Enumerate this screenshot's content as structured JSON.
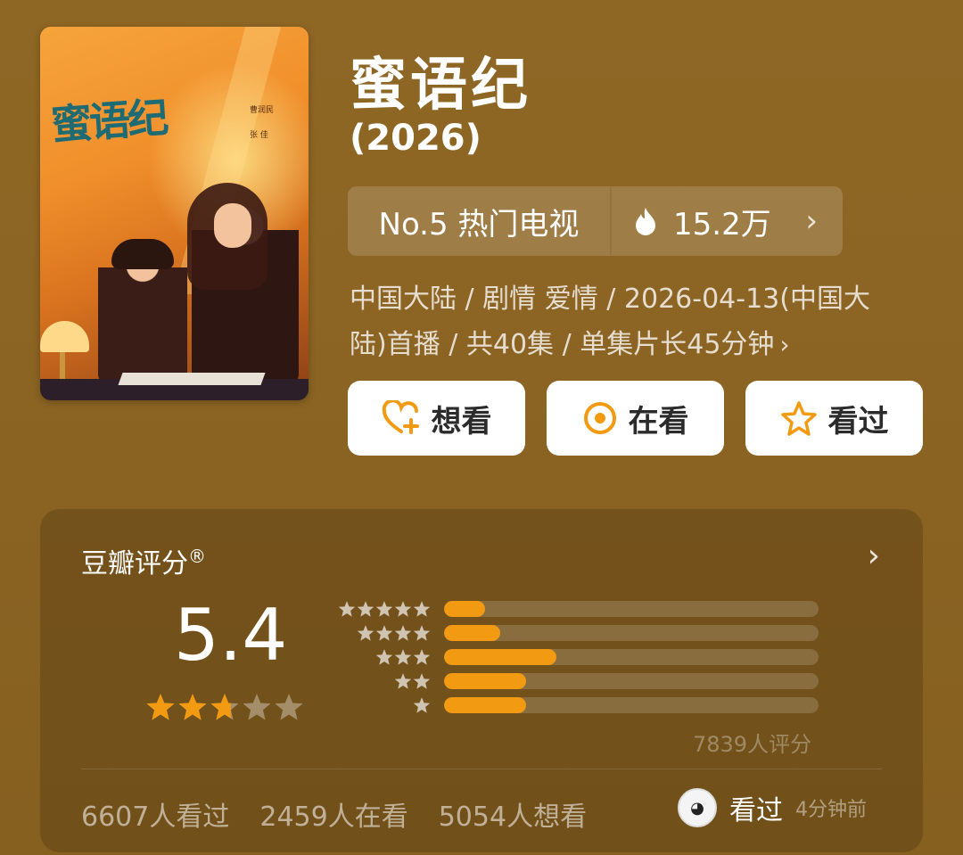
{
  "title": "蜜语纪",
  "year": "(2026)",
  "poster": {
    "title_art": "蜜语纪",
    "credits": [
      "曹润民",
      "张 佳"
    ]
  },
  "rank": {
    "label": "No.5 热门电视",
    "heat": "15.2万"
  },
  "meta_text": "中国大陆 / 剧情 爱情 / 2026-04-13(中国大陆)首播 / 共40集 / 单集片长45分钟",
  "actions": [
    {
      "label": "想看",
      "icon": "heart-plus-icon"
    },
    {
      "label": "在看",
      "icon": "target-icon"
    },
    {
      "label": "看过",
      "icon": "star-outline-icon"
    }
  ],
  "rating": {
    "label": "豆瓣评分",
    "mark": "®",
    "score": "5.4",
    "score_stars_fraction": 0.54,
    "distribution": [
      {
        "stars": 5,
        "fraction": 0.11
      },
      {
        "stars": 4,
        "fraction": 0.15
      },
      {
        "stars": 3,
        "fraction": 0.3
      },
      {
        "stars": 2,
        "fraction": 0.22
      },
      {
        "stars": 1,
        "fraction": 0.22
      }
    ],
    "votes": "7839人评分"
  },
  "stats": {
    "watched": "6607人看过",
    "watching": "2459人在看",
    "want": "5054人想看"
  },
  "friend": {
    "action": "看过",
    "time": "4分钟前"
  },
  "colors": {
    "background": "#8c6523",
    "accent": "#f29a12"
  }
}
